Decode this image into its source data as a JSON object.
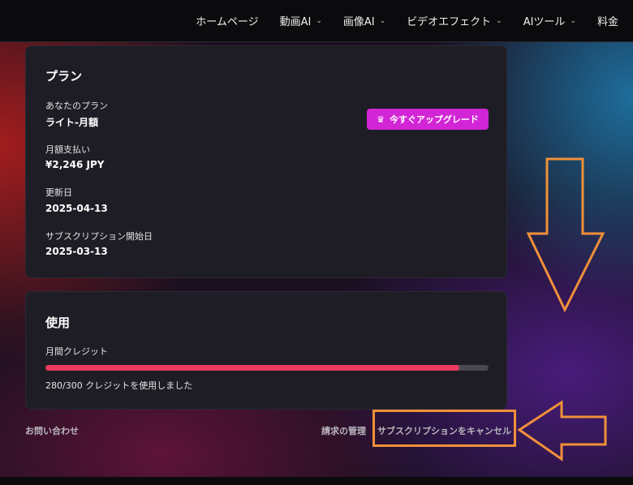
{
  "nav": {
    "items": [
      {
        "label": "ホームページ",
        "dropdown": false
      },
      {
        "label": "動画AI",
        "dropdown": true
      },
      {
        "label": "画像AI",
        "dropdown": true
      },
      {
        "label": "ビデオエフェクト",
        "dropdown": true
      },
      {
        "label": "AIツール",
        "dropdown": true
      },
      {
        "label": "料金",
        "dropdown": false
      }
    ],
    "chevron": "⌄"
  },
  "plan": {
    "title": "プラン",
    "current_plan_label": "あなたのプラン",
    "current_plan_value": "ライト-月額",
    "monthly_payment_label": "月額支払い",
    "monthly_payment_value": "¥2,246 JPY",
    "renewal_label": "更新日",
    "renewal_value": "2025-04-13",
    "start_label": "サブスクリプション開始日",
    "start_value": "2025-03-13",
    "upgrade_button": "今すぐアップグレード",
    "upgrade_icon": "crown-icon"
  },
  "usage": {
    "title": "使用",
    "credits_label": "月間クレジット",
    "used": 280,
    "total": 300,
    "used_text": "280/300 クレジットを使用しました",
    "bar_color": "#f03a5f"
  },
  "footer": {
    "contact": "お問い合わせ",
    "billing": "請求の管理",
    "cancel": "サブスクリプションをキャンセル"
  },
  "colors": {
    "accent": "#d225d6",
    "annotation": "#f0903a"
  }
}
